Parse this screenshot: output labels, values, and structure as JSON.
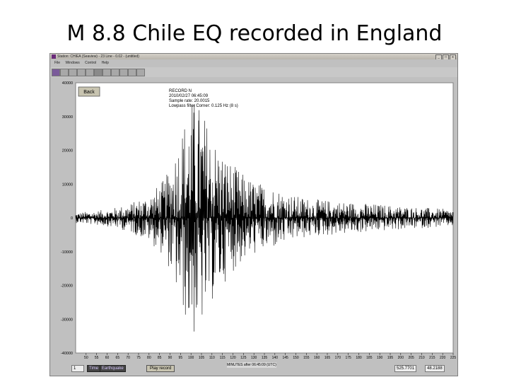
{
  "slide": {
    "title": "M 8.8 Chile EQ recorded in England"
  },
  "window": {
    "title": "Station: CHIEA (Seaview) - 23 Line - 0.02 - (untitled)",
    "menu": [
      "File",
      "Windows",
      "Control",
      "Help"
    ],
    "controls": {
      "minimize": "_",
      "maximize": "□",
      "close": "x"
    }
  },
  "back_button": "Back",
  "info": [
    "RECORD N",
    "2010/02/27 06:45:09",
    "Sample rate: 20.0015",
    "Lowpass filter Corner: 0.125 Hz (8 s)"
  ],
  "statusbar": {
    "channel": "1",
    "mode_left": "Time",
    "mode_right": "Earthquake",
    "play_button": "Play record",
    "axis_label": "MINUTES after 06:45:09 (UTC)",
    "left_box": "525.7701",
    "right_box": "48.2188"
  },
  "colors": {
    "background": "#ffffff",
    "frame": "#c0c0c0",
    "trace": "#000000"
  },
  "chart_data": {
    "type": "line",
    "title": "",
    "xlabel": "MINUTES after 06:45:09 (UTC)",
    "ylabel": "",
    "xlim": [
      45,
      225
    ],
    "ylim": [
      -40000,
      40000
    ],
    "x_ticks": [
      50,
      55,
      60,
      65,
      70,
      75,
      80,
      85,
      90,
      95,
      100,
      105,
      110,
      115,
      120,
      125,
      130,
      135,
      140,
      145,
      150,
      155,
      160,
      165,
      170,
      175,
      180,
      185,
      190,
      195,
      200,
      205,
      210,
      215,
      220,
      225
    ],
    "y_ticks": [
      40000,
      30000,
      20000,
      10000,
      0,
      -10000,
      -20000,
      -30000,
      -40000
    ],
    "envelope": {
      "x": [
        45,
        60,
        70,
        80,
        88,
        93,
        97,
        101,
        104,
        107,
        110,
        115,
        120,
        125,
        130,
        140,
        150,
        160,
        180,
        200,
        225
      ],
      "y": [
        1500,
        2500,
        4000,
        7000,
        12000,
        22000,
        30000,
        36000,
        34000,
        30000,
        25000,
        20000,
        16000,
        13000,
        11000,
        9000,
        6500,
        5500,
        4500,
        3500,
        2500
      ]
    },
    "grid": false,
    "legend": "none"
  }
}
